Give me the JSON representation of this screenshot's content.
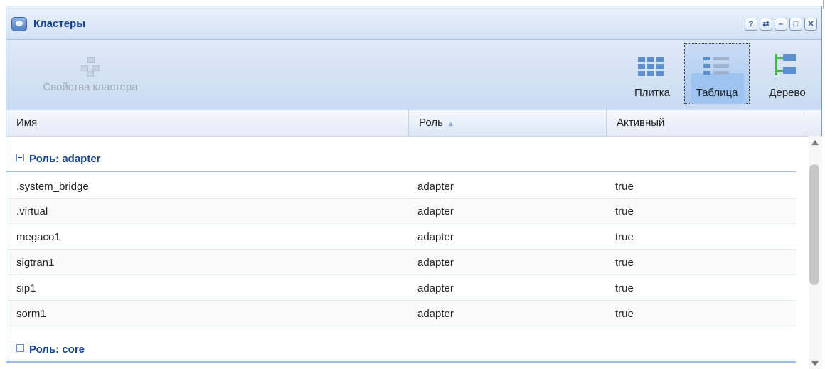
{
  "window": {
    "title": "Кластеры",
    "tools": [
      "help-icon",
      "refresh-icon",
      "minimize-icon",
      "maximize-icon",
      "close-icon"
    ]
  },
  "toolbar": {
    "cluster_properties_label": "Свойства кластера",
    "view_tile_label": "Плитка",
    "view_table_label": "Таблица",
    "view_tree_label": "Дерево"
  },
  "table": {
    "columns": [
      "Имя",
      "Роль",
      "Активный"
    ],
    "sort_column": "Роль",
    "groups": [
      {
        "label": "Роль: adapter",
        "rows": [
          {
            "name": ".system_bridge",
            "role": "adapter",
            "active": "true"
          },
          {
            "name": ".virtual",
            "role": "adapter",
            "active": "true"
          },
          {
            "name": "megaco1",
            "role": "adapter",
            "active": "true"
          },
          {
            "name": "sigtran1",
            "role": "adapter",
            "active": "true"
          },
          {
            "name": "sip1",
            "role": "adapter",
            "active": "true"
          },
          {
            "name": "sorm1",
            "role": "adapter",
            "active": "true"
          }
        ]
      },
      {
        "label": "Роль: core",
        "rows": []
      }
    ]
  },
  "colors": {
    "title_text": "#15428b",
    "accent": "#99bbe8"
  }
}
